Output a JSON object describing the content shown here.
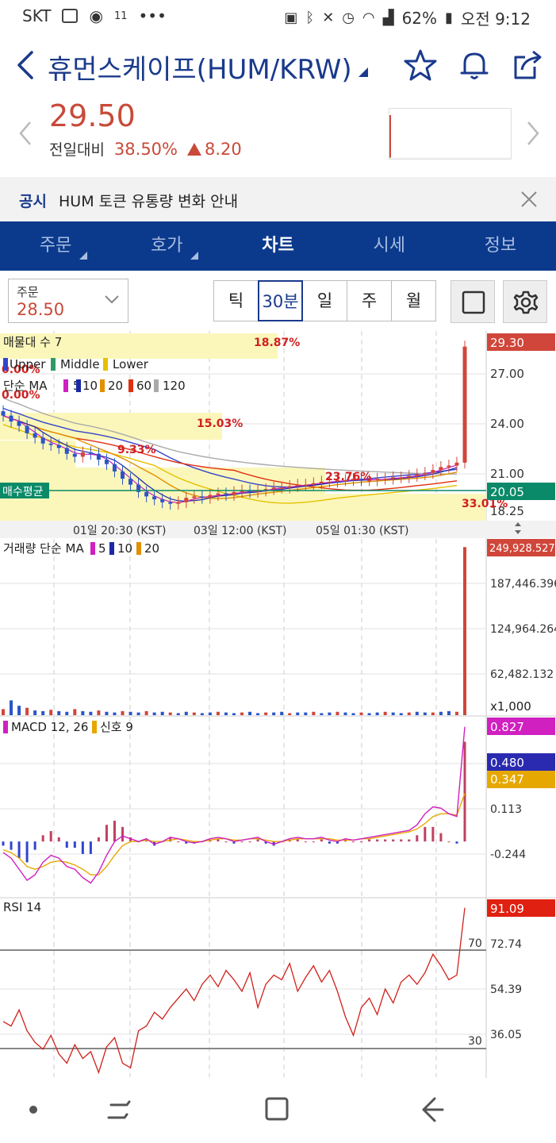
{
  "status_bar": {
    "carrier": "SKT",
    "net_label": "11",
    "battery": "62%",
    "time": "오전 9:12"
  },
  "header": {
    "title": "휴먼스케이프(HUM/KRW)"
  },
  "quote": {
    "price": "29.50",
    "change_label": "전일대비",
    "change_pct": "38.50%",
    "change_amount": "8.20"
  },
  "notice": {
    "tag": "공시",
    "text": "HUM 토큰 유통량 변화 안내"
  },
  "tabs": [
    {
      "label": "주문"
    },
    {
      "label": "호가"
    },
    {
      "label": "차트"
    },
    {
      "label": "시세"
    },
    {
      "label": "정보"
    }
  ],
  "toolbar": {
    "order_label": "주문",
    "order_value": "28.50",
    "periods": [
      "틱",
      "30분",
      "일",
      "주",
      "월"
    ],
    "active_period": "30분"
  },
  "chart_data": [
    {
      "type": "candlestick",
      "panel": "price",
      "legend": {
        "vp": "매물대 수 7",
        "bb": [
          "Upper",
          "Middle",
          "Lower"
        ],
        "ma_prefix": "단순 MA",
        "ma": [
          "5",
          "10",
          "20",
          "60",
          "120"
        ]
      },
      "y_ticks": [
        "27.00",
        "24.00",
        "21.00",
        "18.25"
      ],
      "ylim": [
        17.5,
        30.2
      ],
      "last_price_label": "29.30",
      "avg_buy_label": "매수평균",
      "avg_buy_value": "20.05",
      "volume_profile_pct": [
        "18.87%",
        "15.03%",
        "9.33%",
        "23.76%",
        "33.01%",
        "0.00%",
        "0.00%"
      ],
      "x_ticks": [
        "01일 20:30 (KST)",
        "03일 12:00 (KST)",
        "05일 01:30 (KST)"
      ],
      "close": [
        24.6,
        24.2,
        23.9,
        23.4,
        23.1,
        22.7,
        22.6,
        22.4,
        22.0,
        21.8,
        22.1,
        22.0,
        21.6,
        21.3,
        20.8,
        20.3,
        19.9,
        19.4,
        19.1,
        18.9,
        18.7,
        18.6,
        18.7,
        19.0,
        19.1,
        19.0,
        19.2,
        19.3,
        19.2,
        19.4,
        19.5,
        19.4,
        19.5,
        19.6,
        19.7,
        19.7,
        19.8,
        19.9,
        19.9,
        20.0,
        20.1,
        20.1,
        20.2,
        20.2,
        20.3,
        20.2,
        20.2,
        20.3,
        20.3,
        20.4,
        20.4,
        20.5,
        20.6,
        20.7,
        20.9,
        21.1,
        21.2,
        21.4,
        29.3
      ]
    },
    {
      "type": "bar",
      "panel": "volume",
      "legend_prefix": "거래량 단순 MA",
      "ma": [
        "5",
        "10",
        "20"
      ],
      "y_ticks": [
        "187,446.396",
        "124,964.264",
        "62,482.132"
      ],
      "unit": "x1,000",
      "last_label": "249,928.527",
      "values": [
        9,
        22,
        14,
        11,
        7,
        6,
        8,
        6,
        5,
        9,
        6,
        5,
        7,
        5,
        4,
        6,
        5,
        4,
        6,
        4,
        5,
        4,
        3,
        5,
        4,
        3,
        4,
        5,
        4,
        3,
        4,
        5,
        3,
        4,
        4,
        5,
        3,
        4,
        4,
        5,
        3,
        4,
        5,
        4,
        3,
        4,
        3,
        4,
        5,
        4,
        3,
        4,
        5,
        4,
        4,
        5,
        6,
        5,
        249.9
      ]
    },
    {
      "type": "line",
      "panel": "macd",
      "legend": "MACD 12, 26",
      "signal_label": "신호 9",
      "y_ticks": [
        "0.113",
        "-0.244"
      ],
      "labels": [
        "0.827",
        "0.480",
        "0.347"
      ],
      "macd": [
        -0.08,
        -0.12,
        -0.2,
        -0.28,
        -0.24,
        -0.15,
        -0.1,
        -0.12,
        -0.18,
        -0.2,
        -0.26,
        -0.3,
        -0.22,
        -0.1,
        0.0,
        0.04,
        0.02,
        0.0,
        0.02,
        -0.02,
        0.0,
        0.03,
        0.02,
        0.0,
        -0.01,
        0.0,
        0.02,
        0.03,
        0.02,
        0.0,
        0.01,
        0.02,
        0.03,
        0.0,
        -0.02,
        0.0,
        0.02,
        0.03,
        0.02,
        0.02,
        0.03,
        0.01,
        0.0,
        0.02,
        0.01,
        0.02,
        0.03,
        0.04,
        0.05,
        0.06,
        0.07,
        0.08,
        0.12,
        0.2,
        0.25,
        0.24,
        0.2,
        0.18,
        0.827
      ],
      "signal": [
        -0.06,
        -0.08,
        -0.12,
        -0.18,
        -0.2,
        -0.18,
        -0.15,
        -0.14,
        -0.15,
        -0.17,
        -0.2,
        -0.24,
        -0.24,
        -0.18,
        -0.1,
        -0.03,
        0.0,
        0.0,
        0.01,
        0.0,
        0.0,
        0.01,
        0.02,
        0.01,
        0.0,
        0.0,
        0.01,
        0.02,
        0.02,
        0.01,
        0.01,
        0.02,
        0.02,
        0.01,
        0.0,
        0.0,
        0.01,
        0.02,
        0.02,
        0.02,
        0.02,
        0.02,
        0.01,
        0.01,
        0.01,
        0.02,
        0.02,
        0.03,
        0.04,
        0.05,
        0.06,
        0.07,
        0.09,
        0.13,
        0.18,
        0.2,
        0.2,
        0.19,
        0.347
      ]
    },
    {
      "type": "line",
      "panel": "rsi",
      "legend": "RSI 14",
      "y_ticks": [
        "72.74",
        "54.39",
        "36.05"
      ],
      "levels": [
        "70",
        "30"
      ],
      "last_label": "91.09",
      "values": [
        42,
        40,
        47,
        38,
        33,
        30,
        36,
        28,
        24,
        32,
        26,
        29,
        20,
        31,
        35,
        24,
        22,
        38,
        40,
        46,
        43,
        48,
        52,
        56,
        51,
        58,
        62,
        57,
        64,
        60,
        55,
        63,
        48,
        58,
        62,
        60,
        67,
        55,
        61,
        66,
        59,
        64,
        55,
        44,
        36,
        48,
        52,
        45,
        56,
        50,
        59,
        62,
        58,
        63,
        71,
        66,
        60,
        62,
        91
      ]
    }
  ]
}
